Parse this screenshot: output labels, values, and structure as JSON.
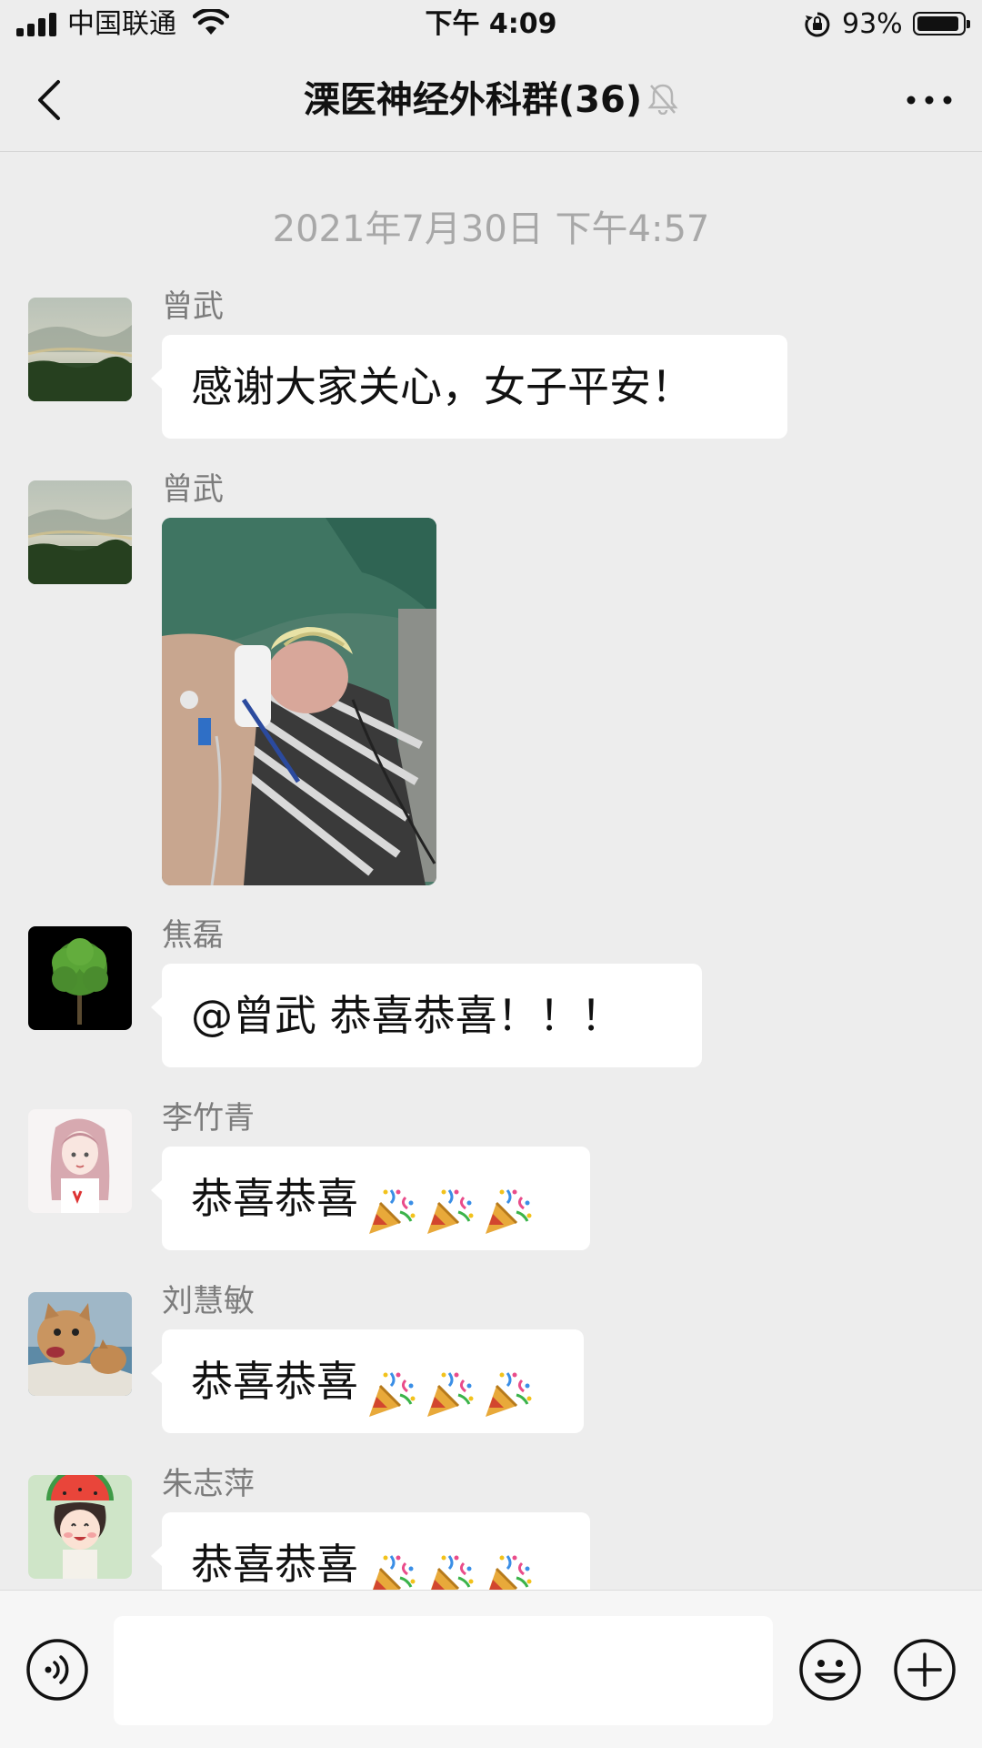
{
  "status_bar": {
    "carrier": "中国联通",
    "time": "下午 4:09",
    "battery_percent_text": "93%",
    "battery_level": 0.93
  },
  "header": {
    "title": "溧医神经外科群(36)",
    "back_icon": "chevron-left-icon",
    "mute_icon": "bell-slash-icon",
    "more_icon": "ellipsis-icon"
  },
  "chat": {
    "timestamp": "2021年7月30日 下午4:57",
    "messages": [
      {
        "sender": "曾武",
        "type": "text",
        "text": "感谢大家关心，女子平安！"
      },
      {
        "sender": "曾武",
        "type": "image"
      },
      {
        "sender": "焦磊",
        "type": "text",
        "text": "@曾武 恭喜恭喜！！！"
      },
      {
        "sender": "李竹青",
        "type": "text",
        "text": "恭喜恭喜",
        "emoji": "party-popper-icon",
        "emoji_count": 3
      },
      {
        "sender": "刘慧敏",
        "type": "text",
        "text": "恭喜恭喜",
        "emoji": "party-popper-icon",
        "emoji_count": 3
      },
      {
        "sender": "朱志萍",
        "type": "text",
        "text": "恭喜恭喜",
        "emoji": "party-popper-icon",
        "emoji_count": 3
      }
    ]
  },
  "input_bar": {
    "voice_icon": "voice-icon",
    "text_value": "",
    "emoji_icon": "smiley-icon",
    "plus_icon": "plus-circle-icon"
  },
  "colors": {
    "background": "#ededed",
    "bubble": "#ffffff",
    "timestamp_text": "#a8a8a8",
    "sender_text": "#7c7c7c"
  }
}
